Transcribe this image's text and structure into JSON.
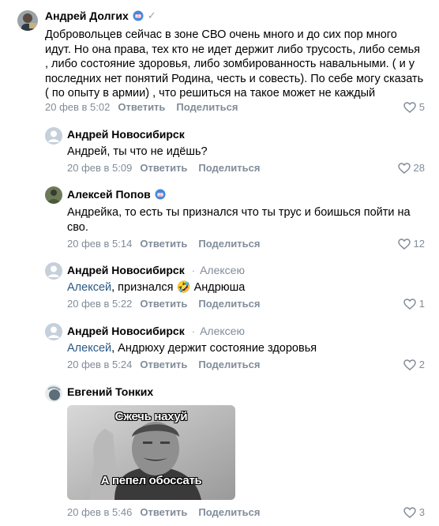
{
  "comments": [
    {
      "author": "Андрей Долгих",
      "avatar_icon": "user-photo",
      "badge_icon": "mask-badge-icon",
      "verified_icon": "check-icon",
      "text": "Добровольцев сейчас в зоне СВО очень много и до сих пор много идут. Но она права, тех кто не идет держит либо трусость, либо семья , либо состояние здоровья, либо зомбированность навальными. ( и у последних нет понятий Родина, честь и совесть). По себе могу сказать ( по опыту в армии) , что решиться на такое может не каждый",
      "date": "20 фев в 5:02",
      "reply_label": "Ответить",
      "share_label": "Поделиться",
      "likes": "5"
    },
    {
      "author": "Андрей Новосибирск",
      "avatar_icon": "default-avatar",
      "text": "Андрей, ты что не идёшь?",
      "date": "20 фев в 5:09",
      "reply_label": "Ответить",
      "share_label": "Поделиться",
      "likes": "28"
    },
    {
      "author": "Алексей Попов",
      "avatar_icon": "user-photo",
      "badge_icon": "mask-badge-icon",
      "text": "Андрейка, то есть ты признался что ты трус и боишься пойти на сво.",
      "date": "20 фев в 5:14",
      "reply_label": "Ответить",
      "share_label": "Поделиться",
      "likes": "12"
    },
    {
      "author": "Андрей Новосибирск",
      "avatar_icon": "default-avatar",
      "reply_to": "Алексею",
      "mention": "Алексей",
      "text_after": ", признался 🤣 Андрюша",
      "date": "20 фев в 5:22",
      "reply_label": "Ответить",
      "share_label": "Поделиться",
      "likes": "1"
    },
    {
      "author": "Андрей Новосибирск",
      "avatar_icon": "default-avatar",
      "reply_to": "Алексею",
      "mention": "Алексей",
      "text_after": ", Андрюху держит состояние здоровья",
      "date": "20 фев в 5:24",
      "reply_label": "Ответить",
      "share_label": "Поделиться",
      "likes": "2"
    },
    {
      "author": "Евгений Тонких",
      "avatar_icon": "user-photo",
      "image": {
        "top_caption": "Сжечь нахуй",
        "bottom_caption": "А пепел обоссать"
      },
      "date": "20 фев в 5:46",
      "reply_label": "Ответить",
      "share_label": "Поделиться",
      "likes": "3"
    }
  ],
  "colors": {
    "link": "#2a5885",
    "meta": "#818c99",
    "default_avatar": "#c5d0db"
  }
}
